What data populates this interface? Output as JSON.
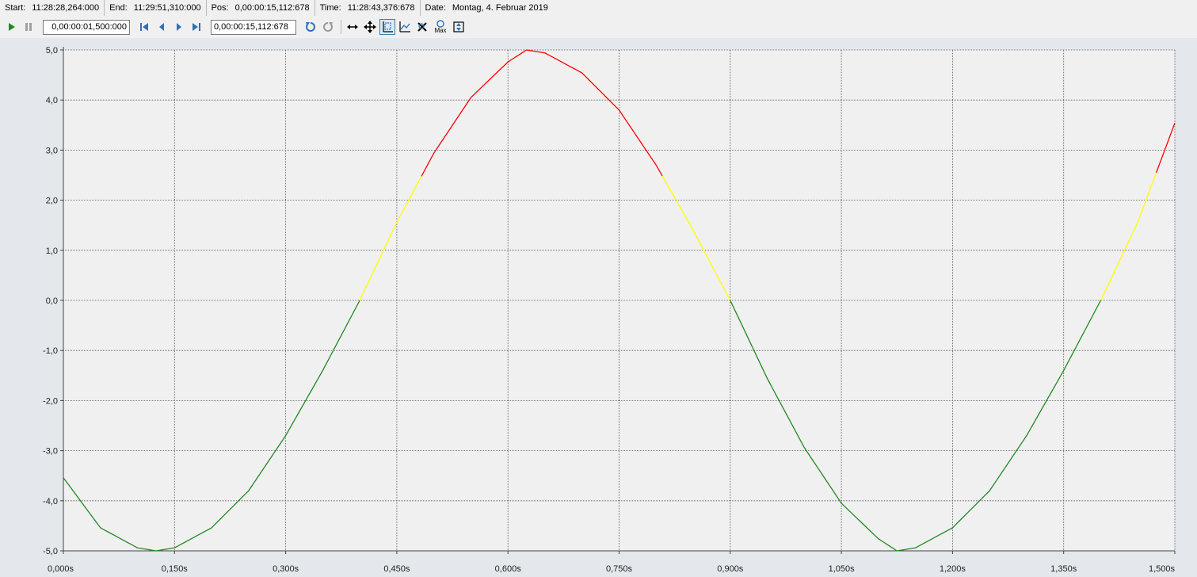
{
  "statusbar": {
    "start_label": "Start:",
    "start_value": "11:28:28,264:000",
    "end_label": "End:",
    "end_value": "11:29:51,310:000",
    "pos_label": "Pos:",
    "pos_value": "0,00:00:15,112:678",
    "time_label": "Time:",
    "time_value": "11:28:43,376:678",
    "date_label": "Date:",
    "date_value": "Montag, 4. Februar 2019"
  },
  "toolbar": {
    "interval_value": "0,00:00:01,500:000",
    "position_value": "0,00:00:15,112:678",
    "icons": [
      "play-icon",
      "pause-icon",
      "skip-first-icon",
      "step-back-icon",
      "step-forward-icon",
      "skip-last-icon",
      "undo-icon",
      "redo-icon",
      "pan-horizontal-icon",
      "pan-move-icon",
      "zoom-axis-icon",
      "zoom-chart-icon",
      "zoom-clear-icon",
      "zoom-max-icon",
      "zoom-fit-icon"
    ],
    "zoom_max_text": "Max"
  },
  "colors": {
    "low": "#1f8a1f",
    "mid": "#ffff00",
    "high": "#ff0000",
    "plot_bg": "#f0f0f0",
    "grid": "#5a5a5a"
  },
  "chart_data": {
    "type": "line",
    "title": "",
    "xlabel": "",
    "ylabel": "",
    "xlim": [
      0,
      1.5
    ],
    "ylim": [
      -5,
      5
    ],
    "x_ticks": [
      "0,000s",
      "0,150s",
      "0,300s",
      "0,450s",
      "0,600s",
      "0,750s",
      "0,900s",
      "1,050s",
      "1,200s",
      "1,350s",
      "1,500s"
    ],
    "y_ticks": [
      "5,0",
      "4,0",
      "3,0",
      "2,0",
      "1,0",
      "0,0",
      "-1,0",
      "-2,0",
      "-3,0",
      "-4,0",
      "-5,0"
    ],
    "grid": true,
    "series": [
      {
        "x": [
          0.0,
          0.05,
          0.1,
          0.125,
          0.15,
          0.2,
          0.25,
          0.3,
          0.35,
          0.4,
          0.45,
          0.5,
          0.55,
          0.6,
          0.625,
          0.65,
          0.7,
          0.75,
          0.8,
          0.85,
          0.9,
          0.95,
          1.0,
          1.05,
          1.1,
          1.125,
          1.15,
          1.2,
          1.25,
          1.3,
          1.35,
          1.4,
          1.45,
          1.5
        ],
        "y": [
          -3.54,
          -4.54,
          -4.94,
          -5.0,
          -4.94,
          -4.54,
          -3.8,
          -2.7,
          -1.4,
          0.0,
          1.56,
          2.94,
          4.05,
          4.76,
          5.0,
          4.94,
          4.54,
          3.8,
          2.7,
          1.4,
          0.0,
          -1.56,
          -2.94,
          -4.05,
          -4.76,
          -5.0,
          -4.94,
          -4.54,
          -3.8,
          -2.7,
          -1.4,
          0.0,
          1.56,
          3.54
        ]
      }
    ],
    "color_bands": [
      {
        "from": -5,
        "to": 0,
        "color": "#1f8a1f"
      },
      {
        "from": 0,
        "to": 2.5,
        "color": "#ffff00"
      },
      {
        "from": 2.5,
        "to": 5,
        "color": "#ff0000"
      }
    ]
  }
}
